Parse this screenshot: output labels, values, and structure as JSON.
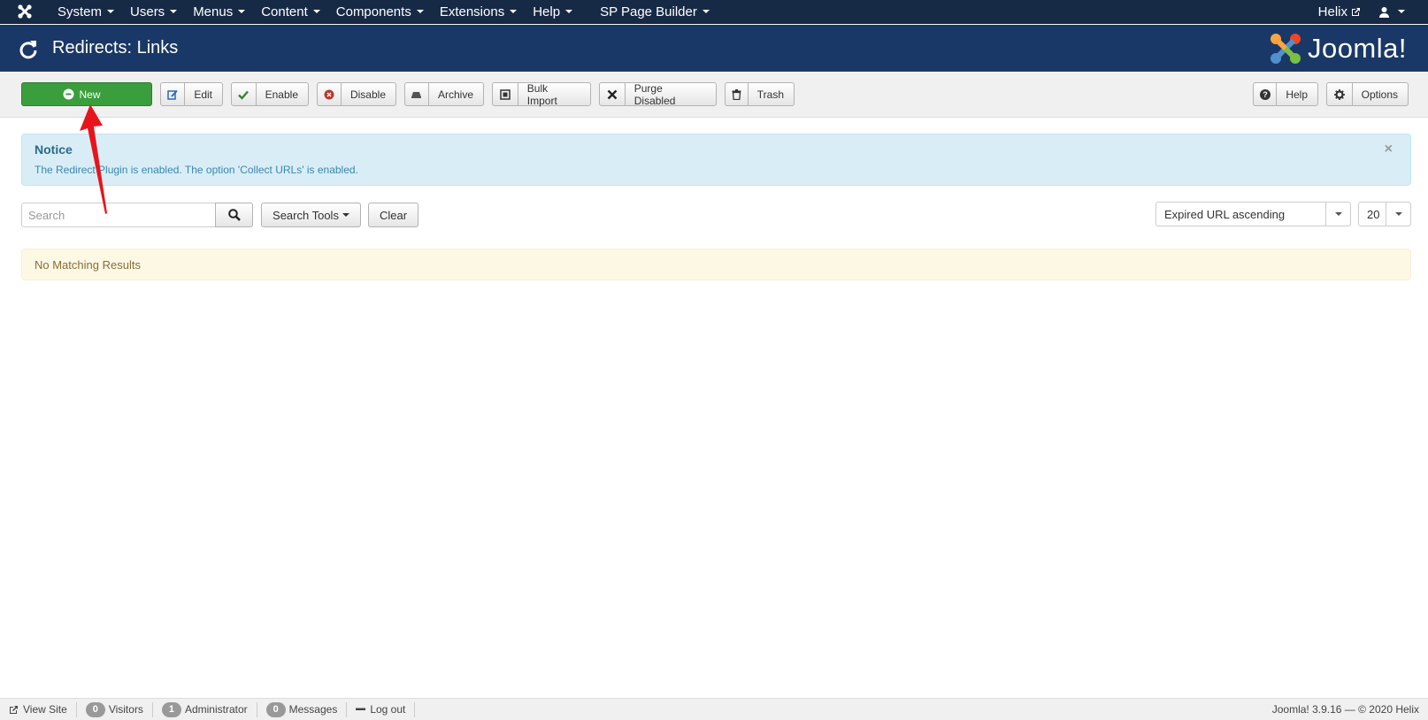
{
  "topnav": {
    "menus": [
      "System",
      "Users",
      "Menus",
      "Content",
      "Components",
      "Extensions",
      "Help",
      "SP Page Builder"
    ],
    "site_name": "Helix"
  },
  "header": {
    "title": "Redirects: Links",
    "brand": "Joomla!"
  },
  "toolbar": {
    "new": "New",
    "edit": "Edit",
    "enable": "Enable",
    "disable": "Disable",
    "archive": "Archive",
    "bulk_import": "Bulk Import",
    "purge_disabled": "Purge Disabled",
    "trash": "Trash",
    "help": "Help",
    "options": "Options"
  },
  "notice": {
    "heading": "Notice",
    "message": "The Redirect Plugin is enabled. The option 'Collect URLs' is enabled.",
    "close": "×"
  },
  "filters": {
    "search_placeholder": "Search",
    "search_tools": "Search Tools",
    "clear": "Clear",
    "ordering": "Expired URL ascending",
    "limit": "20"
  },
  "results": {
    "message": "No Matching Results"
  },
  "footer": {
    "view_site": "View Site",
    "visitors_count": "0",
    "visitors": "Visitors",
    "admin_count": "1",
    "administrator": "Administrator",
    "messages_count": "0",
    "messages": "Messages",
    "logout": "Log out",
    "version": "Joomla! 3.9.16  —  © 2020 Helix"
  },
  "colors": {
    "topnav_bg": "#172a45",
    "header_bg": "#1a3867",
    "new_button": "#3a9e3c",
    "annotation_arrow": "#e8141b"
  }
}
